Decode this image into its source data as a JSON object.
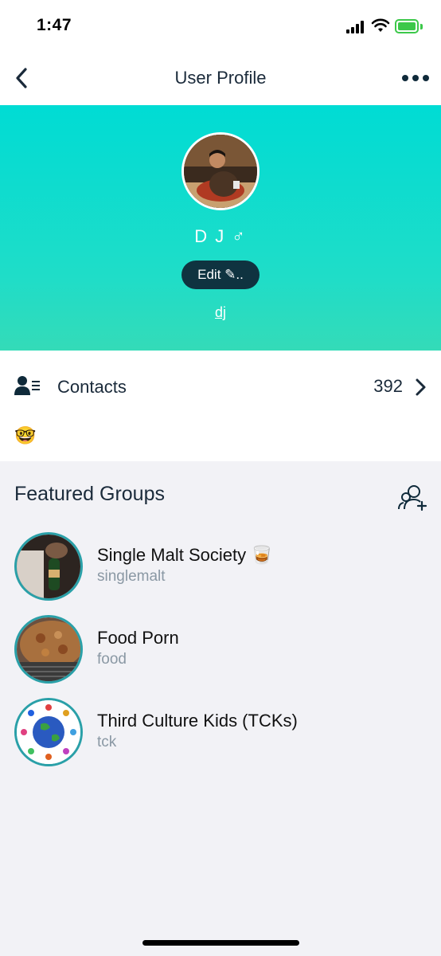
{
  "status_bar": {
    "time": "1:47"
  },
  "nav": {
    "title": "User Profile"
  },
  "profile": {
    "display_name": "D J ♂",
    "edit_label": "Edit ✎..",
    "username": "dj"
  },
  "contacts": {
    "label": "Contacts",
    "count": "392"
  },
  "emoji_badge": "🤓",
  "featured": {
    "title": "Featured Groups",
    "groups": [
      {
        "name": "Single Malt Society 🥃",
        "handle": "singlemalt"
      },
      {
        "name": "Food Porn",
        "handle": "food"
      },
      {
        "name": "Third Culture Kids (TCKs)",
        "handle": "tck"
      }
    ]
  },
  "colors": {
    "hero_top": "#00dcd4",
    "hero_bottom": "#34dbb8",
    "accent_dark": "#0f3340",
    "ring": "#2aa0a8"
  }
}
